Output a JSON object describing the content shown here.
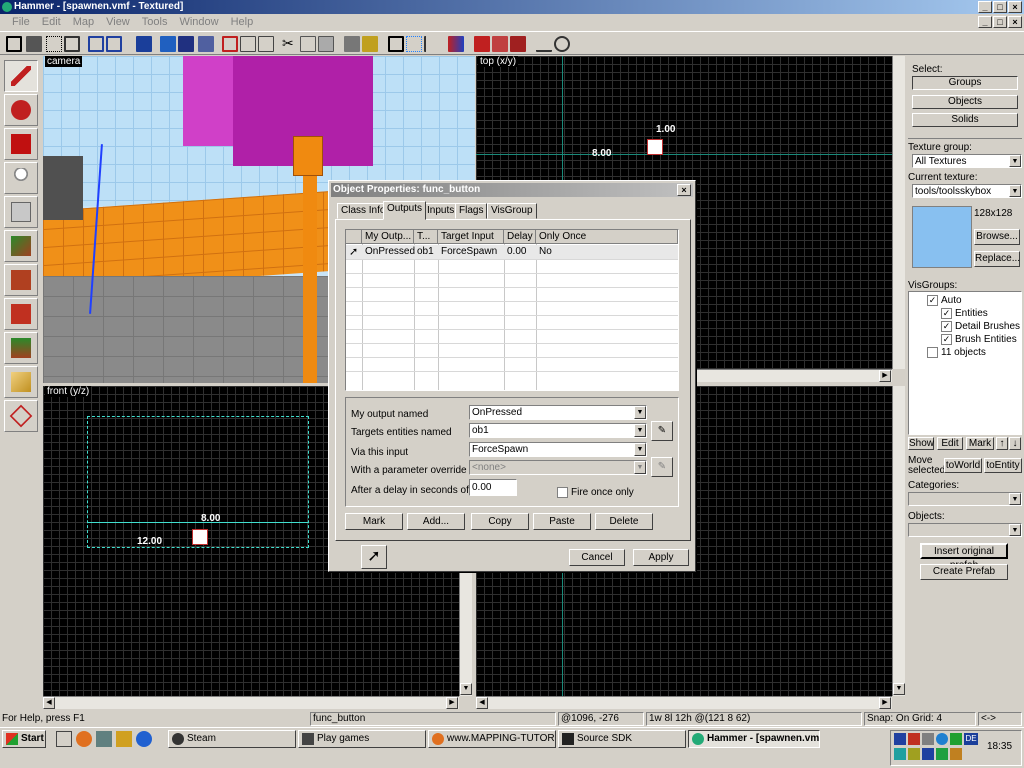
{
  "window": {
    "title": "Hammer - [spawnen.vmf - Textured]"
  },
  "menu": [
    "File",
    "Edit",
    "Map",
    "View",
    "Tools",
    "Window",
    "Help"
  ],
  "views": {
    "camera": "camera",
    "top": "top (x/y)",
    "front": "front (y/z)",
    "top_labels": {
      "a": "1.00",
      "b": "8.00"
    },
    "front_labels": {
      "a": "8.00",
      "b": "12.00"
    }
  },
  "right_panel": {
    "select_label": "Select:",
    "select_buttons": [
      "Groups",
      "Objects",
      "Solids"
    ],
    "texture_group_label": "Texture group:",
    "texture_group_value": "All Textures",
    "current_texture_label": "Current texture:",
    "current_texture_value": "tools/toolsskybox",
    "texture_size": "128x128",
    "browse": "Browse...",
    "replace": "Replace...",
    "visgroups_label": "VisGroups:",
    "visgroups": [
      "Auto",
      "Entities",
      "Detail Brushes",
      "Brush Entities",
      "11 objects"
    ],
    "vg_buttons": [
      "Show",
      "Edit",
      "Mark"
    ],
    "move_selected_label": "Move selected:",
    "to_world": "toWorld",
    "to_entity": "toEntity",
    "categories_label": "Categories:",
    "objects_label": "Objects:",
    "insert_prefab": "Insert original prefab",
    "create_prefab": "Create Prefab"
  },
  "dialog": {
    "title": "Object Properties: func_button",
    "tabs": [
      "Class Info",
      "Outputs",
      "Inputs",
      "Flags",
      "VisGroup"
    ],
    "columns": [
      "My Outp...",
      "T...",
      "Target Input",
      "Delay",
      "Only Once"
    ],
    "row": {
      "output": "OnPressed",
      "target": "ob1",
      "input": "ForceSpawn",
      "delay": "0.00",
      "once": "No"
    },
    "fields": {
      "output_label": "My output named",
      "output_value": "OnPressed",
      "targets_label": "Targets entities named",
      "targets_value": "ob1",
      "via_label": "Via this input",
      "via_value": "ForceSpawn",
      "param_label": "With a parameter override of",
      "param_value": "<none>",
      "delay_label": "After a delay in seconds of",
      "delay_value": "0.00",
      "fire_once": "Fire once only"
    },
    "buttons": [
      "Mark",
      "Add...",
      "Copy",
      "Paste",
      "Delete"
    ],
    "cancel": "Cancel",
    "apply": "Apply"
  },
  "status": {
    "help": "For Help, press F1",
    "object": "func_button",
    "coords": "@1096, -276",
    "size": "1w 8l 12h @(121 8 62)",
    "snap": "Snap: On Grid: 4",
    "arrows": "<->"
  },
  "taskbar": {
    "start": "Start",
    "tasks": [
      "Steam",
      "Play games",
      "www.MAPPING-TUTORIA...",
      "Source SDK",
      "Hammer - [spawnen.vmf ..."
    ],
    "lang": "DE",
    "clock": "18:35"
  }
}
